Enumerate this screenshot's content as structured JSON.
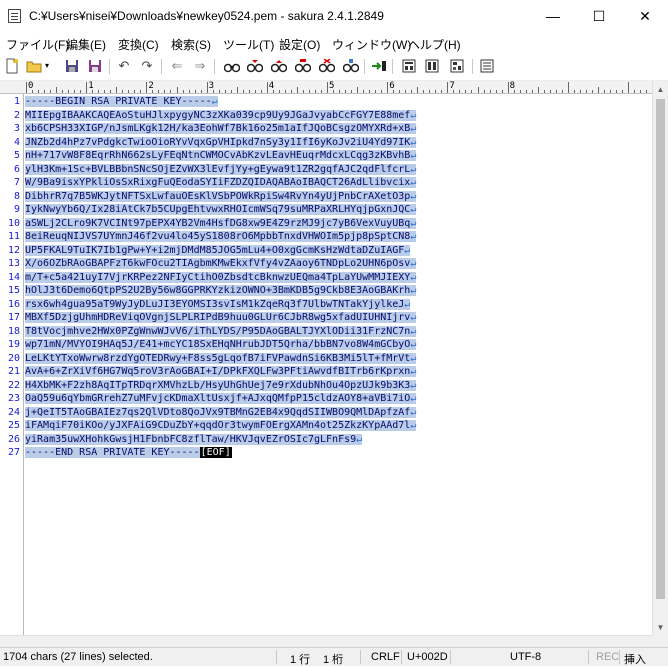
{
  "window": {
    "title": "C:¥Users¥nisei¥Downloads¥newkey0524.pem - sakura 2.4.1.2849",
    "minimize": "—",
    "maximize": "☐",
    "close": "✕"
  },
  "menu": [
    "ファイル(F)",
    "編集(E)",
    "変換(C)",
    "検索(S)",
    "ツール(T)",
    "設定(O)",
    "ウィンドウ(W)",
    "ヘルプ(H)"
  ],
  "toolbar": {
    "icons": [
      "new-file-icon",
      "open-file-icon",
      "save-icon",
      "save-as-icon",
      "undo-icon",
      "redo-icon",
      "jump-back-icon",
      "jump-forward-icon",
      "search-icon",
      "search-prev-icon",
      "search-next-icon",
      "replace-icon",
      "clear-mark-icon",
      "grep-icon",
      "outline-icon",
      "settings-icon",
      "font-icon",
      "print-preview-icon"
    ]
  },
  "ruler": {
    "labels": [
      "0",
      "1",
      "2",
      "3",
      "4",
      "5",
      "6",
      "7",
      "8"
    ]
  },
  "editor": {
    "line_numbers": [
      "1",
      "2",
      "3",
      "4",
      "5",
      "6",
      "7",
      "8",
      "9",
      "10",
      "11",
      "12",
      "13",
      "14",
      "15",
      "16",
      "17",
      "18",
      "19",
      "20",
      "21",
      "22",
      "23",
      "24",
      "25",
      "26",
      "27"
    ],
    "lines": [
      "-----BEGIN RSA PRIVATE KEY-----",
      "MIIEpgIBAAKCAQEAoStuHJlxpygyNC3zXKa039cp9Uy9JGaJvyabCcFGY7E88mef",
      "xb6CPSH33XIGP/nJsmLKgk12H/ka3EohWf7Bk16o25m1aIfJQoBCsgzOMYXRd+xB",
      "JNZb2d4hPz7vPdgkcTwioOioRYvVqxGpVHIpkd7nSy3y1IfI6yKoJv2iU4Yd97IK",
      "nH+717vW8F8EqrRhN662sLyFEqNtnCWMOCvAbKzvLEavHEuqrMdcxLCqg3zKBvhB",
      "ylH3Km+1Sc+BVLBBbnSNcSOjEZvWX3lEvfjYy+gEywa9t1ZR2gqfAJC2qdFlfcrL",
      "W/9Ba9isxYPkliOsSxRixgFuQEodaSYIiFZDZQIDAQABAoIBAQCT26AdLlibvcix",
      "DibhrR7q7B5WKJytNFTSxLwfauOEsKlVSbPOWkRpiSw4RvYn4yUjPnbCrAXetO3p",
      "IykNwyYb6Q/Ix28iAtCk7b5CUpgEhtvwxRHOIcmWSq79suMRPaXRLHYqjpGxnJQC",
      "aSWLj2CLro9K7VCINt97pEPX4YB2Vm4HsfDG8xw9E4Z9rzMJ9jc7yB6VexVuyUBq",
      "8eiReuqNIJVS7UYmnJ46f2vu4lo45yS1808rO6MpbbTnxdVHWOIm5pjp8pSptCN8",
      "UP5FKAL9TuIK7Ib1gPw+Y+i2mjDMdM85JOG5mLu4+O0xgGcmKsHzWdtaDZuIAGF",
      "X/o6OZbRAoGBAPFzT6kwFOcu2TIAgbmKMwEkxfVfy4vZAaoy6TNDpLo2UHN6pOsv",
      "m/T+c5a421uyI7VjrKRPez2NFIyCtihO0ZbsdtcBknwzUEQma4TpLaYUwMMJIEXY",
      "hOlJ3t6Demo6QtpPS2U2By56w8GGPRKYzkizOWNO+3BmKDB5g9Ckb8E3AoGBAKrh",
      "rsx6wh4gua95aT9WyJyDLuJI3EYOMSI3svIsM1kZqeRq3f7UlbwTNTakYjylkeJ",
      "MBXf5DzjgUhmHDReViqOVgnjSLPLRIPdB9huu0GLUr6CJbR8wg5xfadUIUHNIjrv",
      "T8tVocjmhve2HWx0PZgWnwWJvV6/iThLYDS/P95DAoGBALTJYXlODii31FrzNC7n",
      "wp71mN/MVYOI9HAq5J/E41+mcYC18SxEHqNHrubJDT5Qrha/bbBN7vo8W4mGCbyO",
      "LeLKtYTxoWwrw8rzdYgOTEDRwy+F8ss5gLqofB7iFVPawdnSi6KB3Mi5lT+fMrVt",
      "AvA+6+ZrXiVf6HG7Wq5roV3rAoGBAI+I/DPkFXQLFw3PFtiAwvdfBITrb6rKprxn",
      "H4XbMK+F2zh8AqITpTRDqrXMVhzLb/HsyUhGhUej7e9rXdubNhOu4OpzUJk9b3K3",
      "OaQ59u6qYbmGRrehZ7uMFvjcKDmaXltUsxjf+AJxqQMfpP15cldzAOY8+aVBi7iO",
      "j+QeIT5TAoGBAIEz7qs2QlVDto8QoJVx9TBMnG2EB4x9QqdSIIWBO9QMlDApfzAf",
      "iFAMqiF70iKOo/yJXFAiG9CDuZbY+qqdOr3twymFOErgXAMn4ot25ZkzKYpAAd7l",
      "yiRam35uwXHohkGwsjH1FbnbFC8zflTaw/HKVJqvEZrOSIc7gLFnFs9",
      "-----END RSA PRIVATE KEY-----"
    ],
    "eof_marker": "[EOF]"
  },
  "status": {
    "selection": "1704 chars (27 lines) selected.",
    "row": "1 行",
    "col": "1 桁",
    "newline": "CRLF",
    "code": "U+002D",
    "encoding": "UTF-8",
    "rec": "REC",
    "mode": "挿入"
  },
  "colors": {
    "selection": "#b9cce8",
    "line_number": "#1a1ad8",
    "text": "#0a0a6a",
    "newline_mark": "#2a6bd0"
  }
}
